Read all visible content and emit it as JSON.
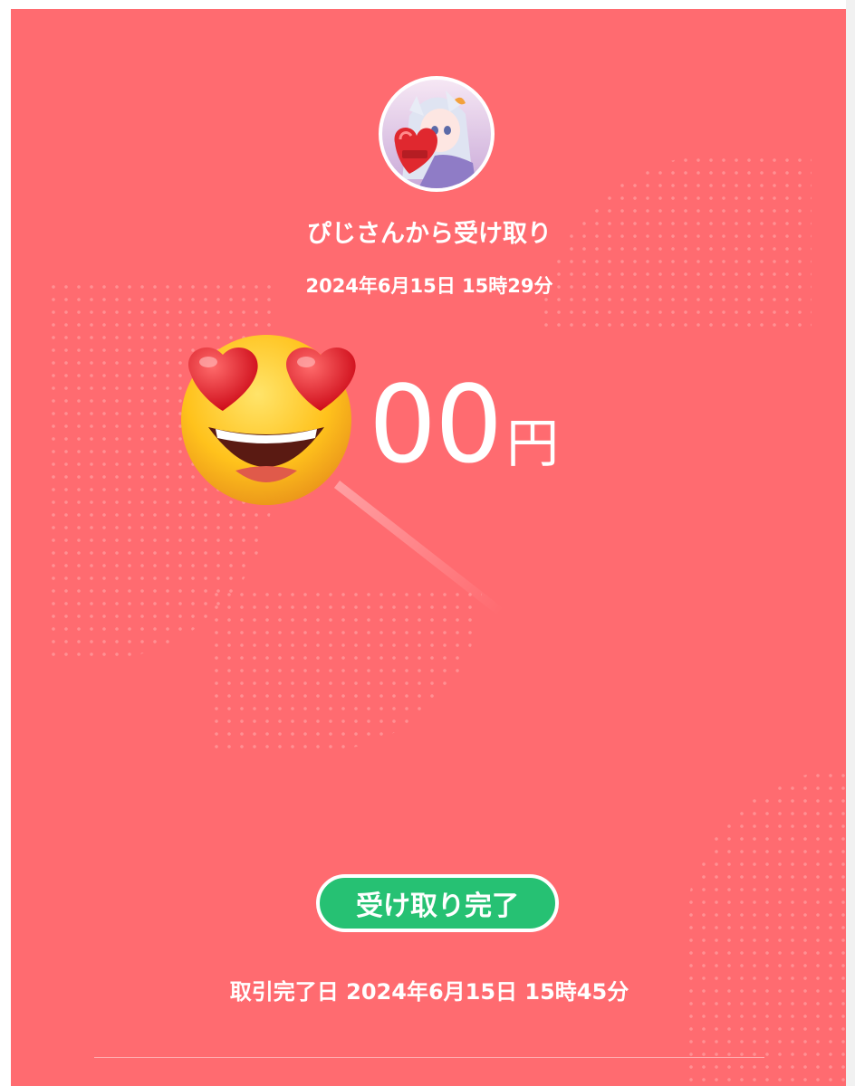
{
  "receipt": {
    "title": "ぴじさんから受け取り",
    "received_date": "2024年6月15日 15時29分",
    "amount_visible_digits": "00",
    "currency": "円",
    "status_label": "受け取り完了",
    "completed_label": "取引完了日",
    "completed_date": "2024年6月15日 15時45分"
  },
  "avatar": {
    "icon": "avatar-anime-girl",
    "caption": "ぴじ"
  },
  "overlay": {
    "icon": "heart-eyes-emoji-icon"
  },
  "colors": {
    "background": "#ff6b70",
    "status_green": "#26c173",
    "text": "#ffffff"
  }
}
